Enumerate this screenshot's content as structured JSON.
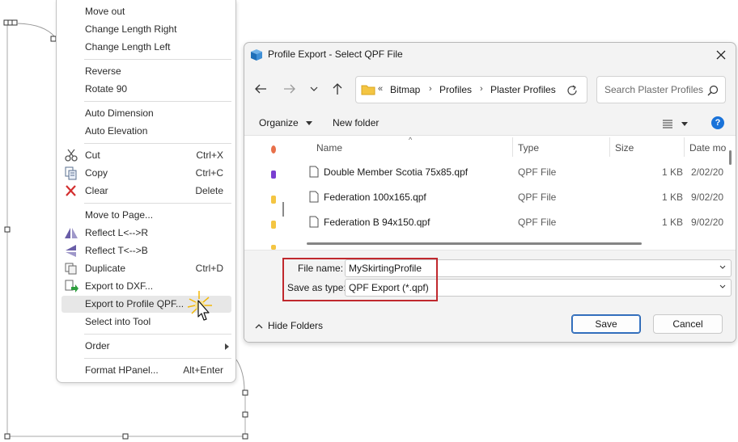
{
  "context_menu": {
    "items": [
      {
        "label": "Move out",
        "shortcut": "",
        "icon": ""
      },
      {
        "label": "Change Length Right",
        "shortcut": "",
        "icon": ""
      },
      {
        "label": "Change Length Left",
        "shortcut": "",
        "icon": ""
      },
      {
        "label": "Reverse",
        "shortcut": "",
        "icon": ""
      },
      {
        "label": "Rotate 90",
        "shortcut": "",
        "icon": ""
      },
      {
        "label": "Auto Dimension",
        "shortcut": "",
        "icon": ""
      },
      {
        "label": "Auto Elevation",
        "shortcut": "",
        "icon": ""
      },
      {
        "label": "Cut",
        "shortcut": "Ctrl+X",
        "icon": "scissors-icon"
      },
      {
        "label": "Copy",
        "shortcut": "Ctrl+C",
        "icon": "copy-icon"
      },
      {
        "label": "Clear",
        "shortcut": "Delete",
        "icon": "red-x-icon"
      },
      {
        "label": "Move to Page...",
        "shortcut": "",
        "icon": ""
      },
      {
        "label": "Reflect L<-->R",
        "shortcut": "",
        "icon": "reflect-horizontal-icon"
      },
      {
        "label": "Reflect T<-->B",
        "shortcut": "",
        "icon": "reflect-vertical-icon"
      },
      {
        "label": "Duplicate",
        "shortcut": "Ctrl+D",
        "icon": "duplicate-icon"
      },
      {
        "label": "Export to DXF...",
        "shortcut": "",
        "icon": "export-dxf-icon"
      },
      {
        "label": "Export to Profile QPF...",
        "shortcut": "",
        "icon": ""
      },
      {
        "label": "Select into Tool",
        "shortcut": "",
        "icon": ""
      },
      {
        "label": "Order",
        "shortcut": "",
        "icon": ""
      },
      {
        "label": "Format HPanel...",
        "shortcut": "Alt+Enter",
        "icon": ""
      }
    ]
  },
  "dialog": {
    "title": "Profile Export - Select QPF File",
    "address": {
      "overflow": "«",
      "crumbs": [
        "Bitmap",
        "Profiles",
        "Plaster Profiles"
      ]
    },
    "search_placeholder": "Search Plaster Profiles",
    "toolbar": {
      "organize": "Organize",
      "new_folder": "New folder",
      "help": "?"
    },
    "columns": {
      "name": "Name",
      "type": "Type",
      "size": "Size",
      "date": "Date mo"
    },
    "files": [
      {
        "name": "Double Member Scotia 75x85.qpf",
        "type": "QPF File",
        "size": "1 KB",
        "date": "2/02/20"
      },
      {
        "name": "Federation 100x165.qpf",
        "type": "QPF File",
        "size": "1 KB",
        "date": "9/02/20"
      },
      {
        "name": "Federation B 94x150.qpf",
        "type": "QPF File",
        "size": "1 KB",
        "date": "9/02/20"
      }
    ],
    "file_name_label": "File name:",
    "file_name_value": "MySkirtingProfile",
    "save_type_label": "Save as type:",
    "save_type_value": "QPF Export (*.qpf)",
    "hide_folders": "Hide Folders",
    "save_button": "Save",
    "cancel_button": "Cancel"
  },
  "colors": {
    "highlight_box": "#c0282d",
    "accent": "#2a66b3",
    "help": "#1a73d9"
  }
}
